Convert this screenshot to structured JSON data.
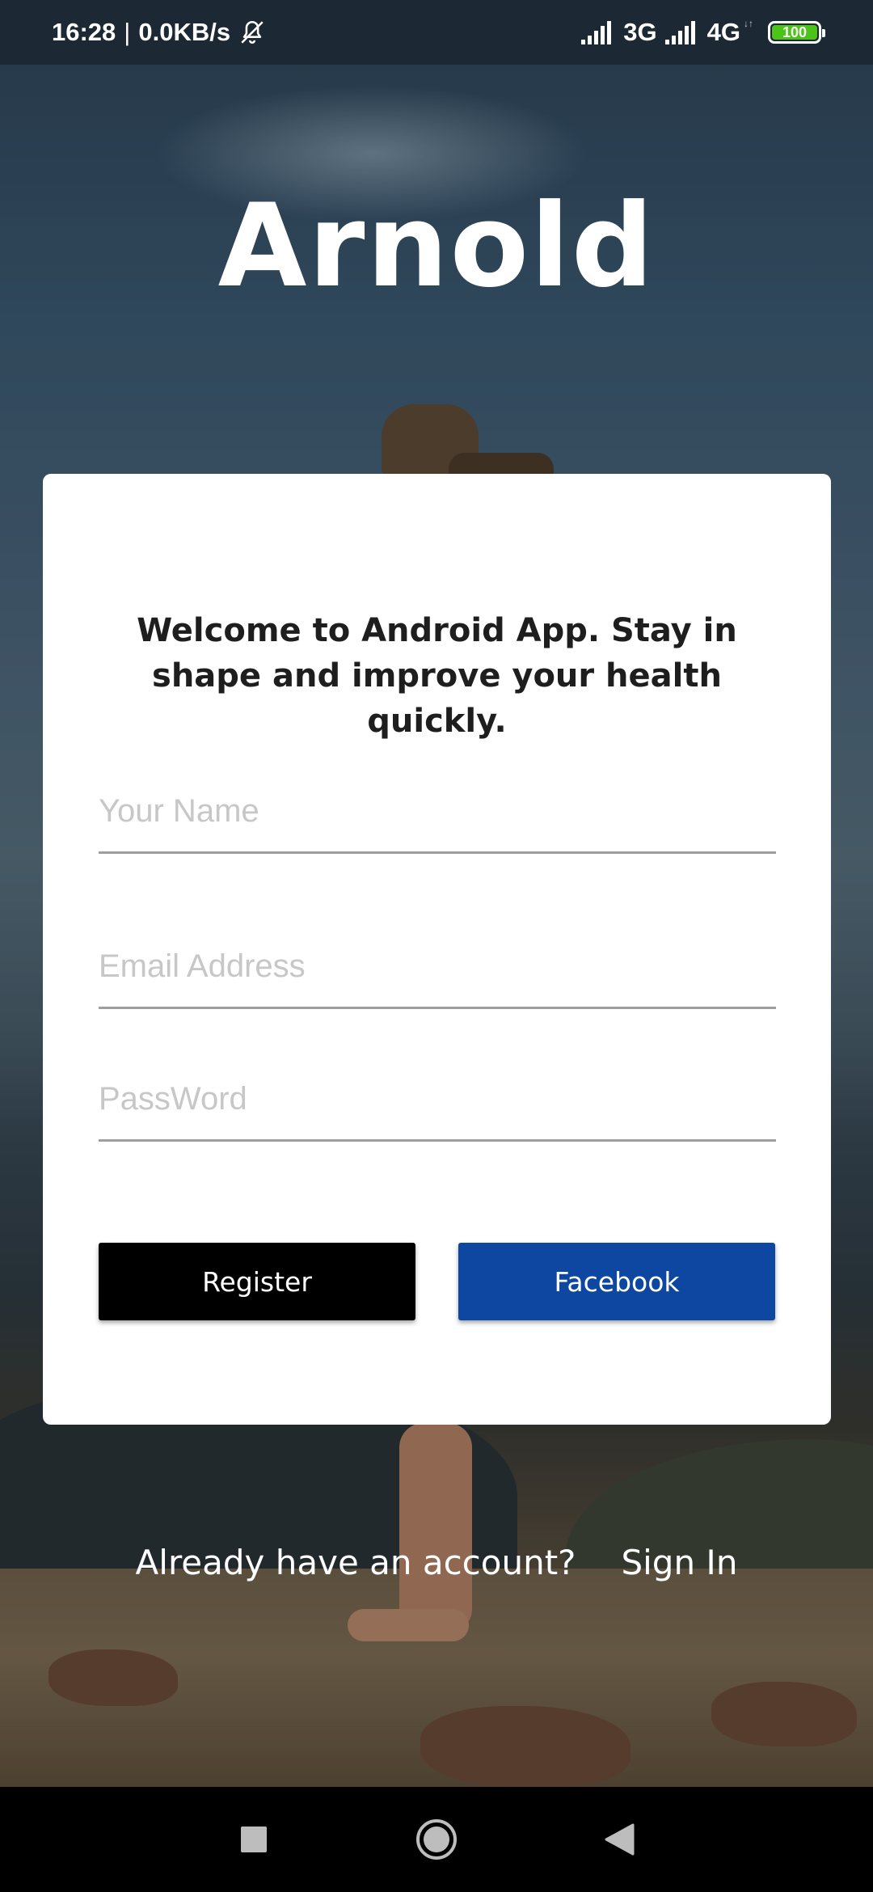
{
  "status_bar": {
    "time": "16:28",
    "separator": "|",
    "speed": "0.0KB/s",
    "network_1": "3G",
    "network_2": "4G",
    "network_2_sub": "↓↑",
    "battery": "100",
    "battery_color": "#4cc417"
  },
  "app": {
    "title": "Arnold"
  },
  "form": {
    "welcome": "Welcome to Android App. Stay in shape and improve your health quickly.",
    "name_placeholder": "Your Name",
    "email_placeholder": "Email Address",
    "password_placeholder": "PassWord",
    "register_label": "Register",
    "facebook_label": "Facebook",
    "facebook_color": "#0d47a1"
  },
  "footer": {
    "prompt": "Already have an account?",
    "signin_label": "Sign In"
  },
  "navigation": {
    "recents_icon": "square-recents-icon",
    "home_icon": "circle-home-icon",
    "back_icon": "triangle-back-icon"
  }
}
